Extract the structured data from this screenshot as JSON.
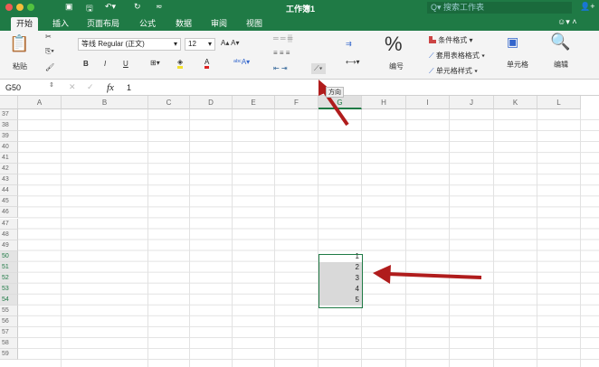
{
  "window": {
    "title": "工作簿1",
    "search_placeholder": "搜索工作表"
  },
  "tabs": [
    "开始",
    "插入",
    "页面布局",
    "公式",
    "数据",
    "审阅",
    "视图"
  ],
  "ribbon": {
    "paste": "粘贴",
    "font": "等线 Regular (正文)",
    "size": "12",
    "bold": "B",
    "italic": "I",
    "underline": "U",
    "number_symbol": "%",
    "number": "编号",
    "cond_format": "条件格式",
    "table_format": "套用表格格式",
    "cell_styles": "单元格样式",
    "cells": "单元格",
    "edit": "编辑",
    "tooltip": "方向"
  },
  "formula_bar": {
    "name_box": "G50",
    "fx": "fx",
    "value": "1"
  },
  "columns": [
    "A",
    "B",
    "C",
    "D",
    "E",
    "F",
    "G",
    "H",
    "I",
    "J",
    "K",
    "L"
  ],
  "rows": [
    "37",
    "38",
    "39",
    "40",
    "41",
    "42",
    "43",
    "44",
    "45",
    "46",
    "47",
    "48",
    "49",
    "50",
    "51",
    "52",
    "53",
    "54",
    "55",
    "56",
    "57",
    "58",
    "59"
  ],
  "cells": {
    "G50": "1",
    "G51": "2",
    "G52": "3",
    "G53": "4",
    "G54": "5"
  },
  "colors": {
    "accent": "#1f7a45",
    "arrow": "#b01c1c"
  }
}
